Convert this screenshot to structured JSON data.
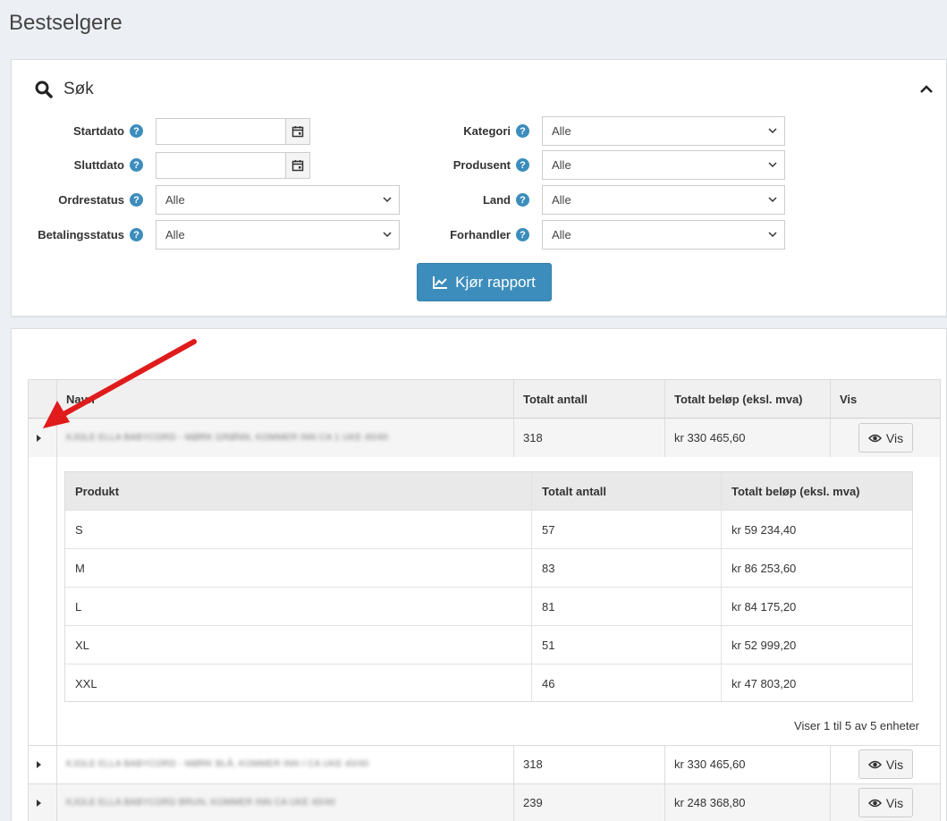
{
  "page": {
    "title": "Bestselgere"
  },
  "search": {
    "title": "Søk",
    "fields": {
      "startdato": {
        "label": "Startdato",
        "value": ""
      },
      "sluttdato": {
        "label": "Sluttdato",
        "value": ""
      },
      "ordrestatus": {
        "label": "Ordrestatus",
        "value": "Alle"
      },
      "betalingsstatus": {
        "label": "Betalingsstatus",
        "value": "Alle"
      },
      "kategori": {
        "label": "Kategori",
        "value": "Alle"
      },
      "produsent": {
        "label": "Produsent",
        "value": "Alle"
      },
      "land": {
        "label": "Land",
        "value": "Alle"
      },
      "forhandler": {
        "label": "Forhandler",
        "value": "Alle"
      }
    },
    "help_glyph": "?",
    "run_button": "Kjør rapport"
  },
  "results": {
    "columns": {
      "name": "Navn",
      "qty": "Totalt antall",
      "amount": "Totalt beløp (eksl. mva)",
      "view": "Vis"
    },
    "view_label": "Vis",
    "rows": [
      {
        "name": "KJOLE ELLA BABYCORD - MØRK GRØNN, KOMMER INN CA 1 UKE 40/40",
        "qty": "318",
        "amount": "kr 330 465,60"
      },
      {
        "name": "KJOLE ELLA BABYCORD - MØRK BLÅ, KOMMER INN I CA UKE 40/40",
        "qty": "318",
        "amount": "kr 330 465,60"
      },
      {
        "name": "KJOLE ELLA BABYCORD BRUN, KOMMER INN CA UKE 40/40",
        "qty": "239",
        "amount": "kr 248 368,80"
      }
    ],
    "detail": {
      "columns": {
        "product": "Produkt",
        "qty": "Totalt antall",
        "amount": "Totalt beløp (eksl. mva)"
      },
      "rows": [
        {
          "product": "S",
          "qty": "57",
          "amount": "kr 59 234,40"
        },
        {
          "product": "M",
          "qty": "83",
          "amount": "kr 86 253,60"
        },
        {
          "product": "L",
          "qty": "81",
          "amount": "kr 84 175,20"
        },
        {
          "product": "XL",
          "qty": "51",
          "amount": "kr 52 999,20"
        },
        {
          "product": "XXL",
          "qty": "46",
          "amount": "kr 47 803,20"
        }
      ],
      "pager_info": "Viser 1 til 5 av 5 enheter"
    }
  },
  "colors": {
    "accent": "#3c8dbc",
    "arrow": "#e01b1b",
    "background": "#ecf0f5"
  }
}
